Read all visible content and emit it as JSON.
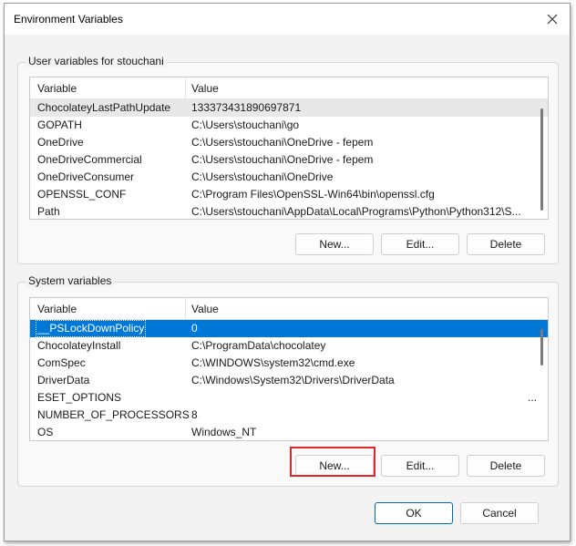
{
  "window": {
    "title": "Environment Variables"
  },
  "user_vars": {
    "label": "User variables for stouchani",
    "header": {
      "variable": "Variable",
      "value": "Value"
    },
    "rows": [
      {
        "variable": "ChocolateyLastPathUpdate",
        "value": "133373431890697871"
      },
      {
        "variable": "GOPATH",
        "value": "C:\\Users\\stouchani\\go"
      },
      {
        "variable": "OneDrive",
        "value": "C:\\Users\\stouchani\\OneDrive - fepem"
      },
      {
        "variable": "OneDriveCommercial",
        "value": "C:\\Users\\stouchani\\OneDrive - fepem"
      },
      {
        "variable": "OneDriveConsumer",
        "value": "C:\\Users\\stouchani\\OneDrive"
      },
      {
        "variable": "OPENSSL_CONF",
        "value": "C:\\Program Files\\OpenSSL-Win64\\bin\\openssl.cfg"
      },
      {
        "variable": "Path",
        "value": "C:\\Users\\stouchani\\AppData\\Local\\Programs\\Python\\Python312\\S..."
      }
    ],
    "buttons": {
      "new": "New...",
      "edit": "Edit...",
      "delete": "Delete"
    }
  },
  "system_vars": {
    "label": "System variables",
    "header": {
      "variable": "Variable",
      "value": "Value"
    },
    "rows": [
      {
        "variable": "__PSLockDownPolicy",
        "value": "0"
      },
      {
        "variable": "ChocolateyInstall",
        "value": "C:\\ProgramData\\chocolatey"
      },
      {
        "variable": "ComSpec",
        "value": "C:\\WINDOWS\\system32\\cmd.exe"
      },
      {
        "variable": "DriverData",
        "value": "C:\\Windows\\System32\\Drivers\\DriverData"
      },
      {
        "variable": "ESET_OPTIONS",
        "value": "",
        "trailing": "..."
      },
      {
        "variable": "NUMBER_OF_PROCESSORS",
        "value": "8"
      },
      {
        "variable": "OS",
        "value": "Windows_NT"
      }
    ],
    "buttons": {
      "new": "New...",
      "edit": "Edit...",
      "delete": "Delete"
    }
  },
  "footer": {
    "ok": "OK",
    "cancel": "Cancel"
  },
  "colors": {
    "selection": "#0078d7",
    "highlight": "#e0262b"
  }
}
